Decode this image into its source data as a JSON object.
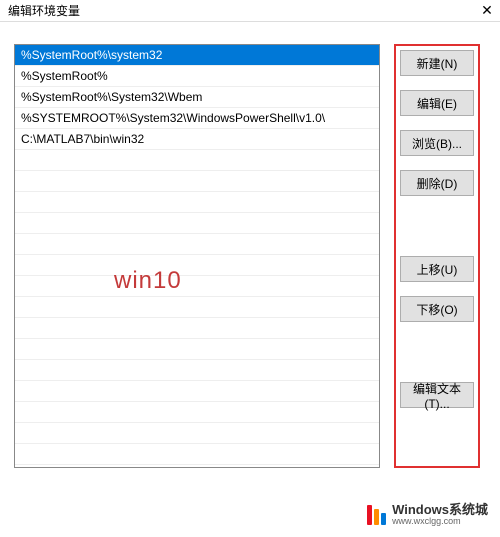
{
  "title": "编辑环境变量",
  "list": {
    "items": [
      "%SystemRoot%\\system32",
      "%SystemRoot%",
      "%SystemRoot%\\System32\\Wbem",
      "%SYSTEMROOT%\\System32\\WindowsPowerShell\\v1.0\\",
      "C:\\MATLAB7\\bin\\win32"
    ],
    "selected_index": 0
  },
  "buttons": {
    "new": "新建(N)",
    "edit": "编辑(E)",
    "browse": "浏览(B)...",
    "delete": "删除(D)",
    "move_up": "上移(U)",
    "move_down": "下移(O)",
    "edit_text": "编辑文本(T)..."
  },
  "watermark": {
    "center": "win10",
    "footer_line1": "Windows系统城",
    "footer_line2": "www.wxclgg.com"
  },
  "accent_selected": "#0078d7",
  "highlight_border": "#e03030"
}
